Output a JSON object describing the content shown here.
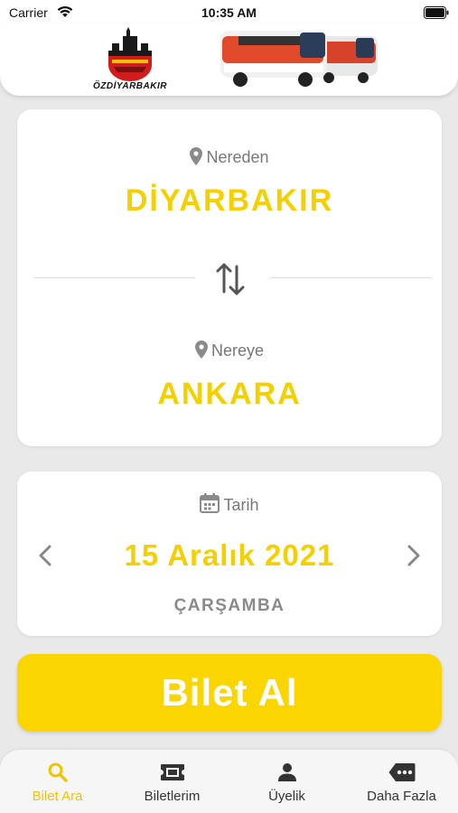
{
  "status_bar": {
    "carrier": "Carrier",
    "time": "10:35 AM"
  },
  "header": {
    "logo_text": "ÖZDİYARBAKIR",
    "bus_icon": "bus-image"
  },
  "route": {
    "from_label": "Nereden",
    "from_city": "DİYARBAKIR",
    "to_label": "Nereye",
    "to_city": "ANKARA",
    "swap_icon": "swap-vertical-icon"
  },
  "date": {
    "label": "Tarih",
    "value": "15 Aralık 2021",
    "day": "ÇARŞAMBA",
    "prev_icon": "chevron-left-icon",
    "next_icon": "chevron-right-icon"
  },
  "buy_button": {
    "label": "Bilet Al"
  },
  "tabbar": {
    "items": [
      {
        "label": "Bilet Ara",
        "icon": "search-icon",
        "active": true
      },
      {
        "label": "Biletlerim",
        "icon": "ticket-icon",
        "active": false
      },
      {
        "label": "Üyelik",
        "icon": "user-icon",
        "active": false
      },
      {
        "label": "Daha Fazla",
        "icon": "more-icon",
        "active": false
      }
    ]
  },
  "colors": {
    "accent": "#fad500",
    "label": "#777777",
    "background": "#e9e9e9",
    "active_tab": "#f0c400"
  }
}
